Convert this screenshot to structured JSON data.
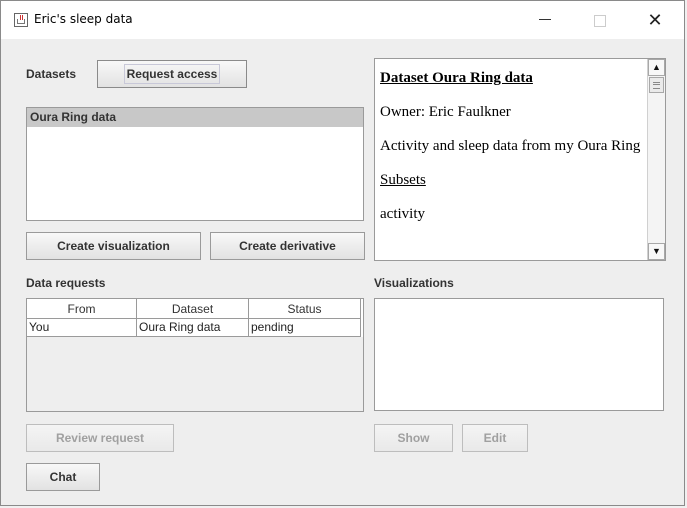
{
  "window": {
    "title": "Eric's sleep data",
    "controls": {
      "minimize": "—",
      "maximize": "☐",
      "close": "✕"
    }
  },
  "datasets": {
    "label": "Datasets",
    "request_access_label": "Request access",
    "items": [
      "Oura Ring data"
    ],
    "selected": "Oura Ring data",
    "create_visualization_label": "Create visualization",
    "create_derivative_label": "Create derivative"
  },
  "detail": {
    "title": "Dataset Oura Ring data",
    "owner": "Owner: Eric Faulkner",
    "description": "Activity and sleep data from my Oura Ring",
    "subsets_label": "Subsets",
    "partial_next_line": "activity"
  },
  "requests": {
    "label": "Data requests",
    "columns": [
      "From",
      "Dataset",
      "Status"
    ],
    "rows": [
      [
        "You",
        "Oura Ring data",
        "pending"
      ]
    ],
    "review_label": "Review request",
    "chat_label": "Chat"
  },
  "visualizations": {
    "label": "Visualizations",
    "show_label": "Show",
    "edit_label": "Edit"
  }
}
